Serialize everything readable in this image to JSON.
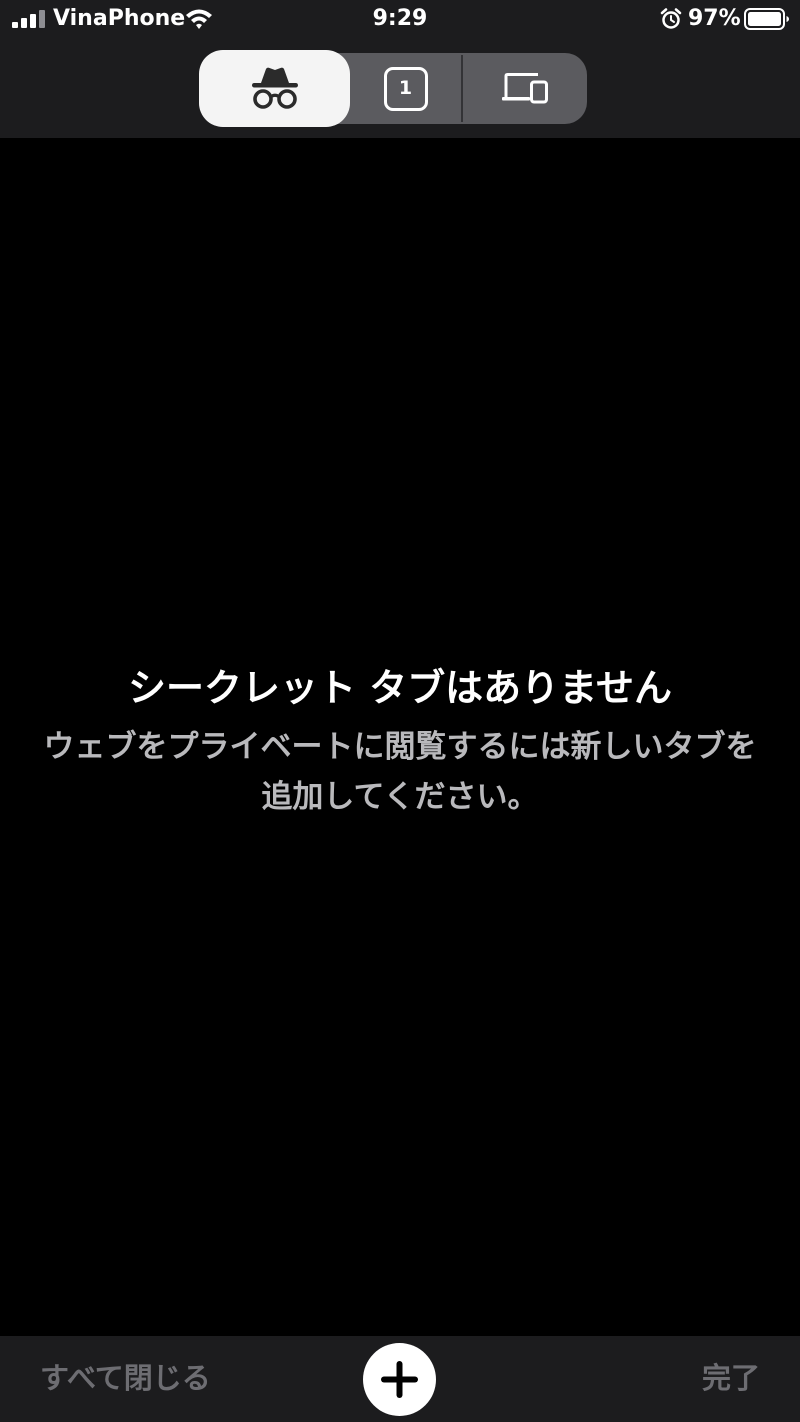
{
  "status_bar": {
    "carrier": "VinaPhone",
    "time": "9:29",
    "battery_percent": "97%",
    "icons": [
      "signal-icon",
      "wifi-icon",
      "alarm-icon",
      "battery-icon"
    ]
  },
  "tab_switcher": {
    "segments": [
      {
        "id": "incognito",
        "icon": "incognito-icon",
        "selected": true
      },
      {
        "id": "regular",
        "icon": "tab-count-icon",
        "count": "1",
        "selected": false
      },
      {
        "id": "devices",
        "icon": "devices-icon",
        "selected": false
      }
    ]
  },
  "empty_state": {
    "title": "シークレット タブはありません",
    "description_line1": "ウェブをプライベートに閲覧するには新しいタブを",
    "description_line2": "追加してください。"
  },
  "toolbar": {
    "close_all_label": "すべて閉じる",
    "add_icon": "plus-icon",
    "done_label": "完了"
  },
  "colors": {
    "background": "#000000",
    "bar_background": "#1c1c1e",
    "segment_background": "#5b5b5f",
    "selected_segment": "#f4f4f4",
    "disabled_text": "#6d6d72",
    "secondary_text": "#b9b9bc"
  }
}
